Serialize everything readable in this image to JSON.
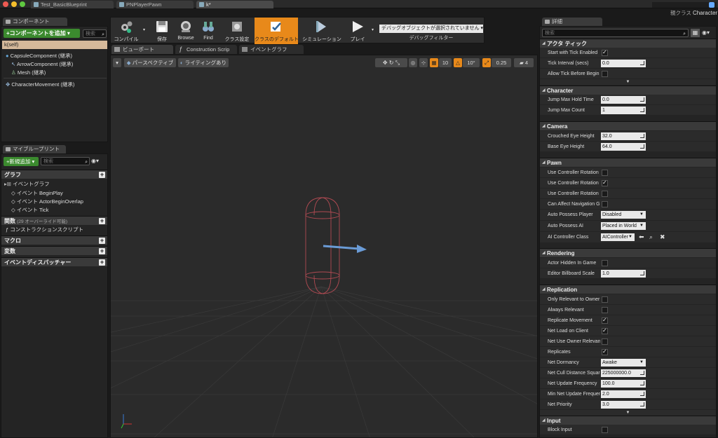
{
  "window": {
    "tabs": [
      "Test_BasicBlueprint",
      "PNPlayerPawn",
      "k*"
    ],
    "parent_class_label": "親クラス",
    "parent_class_value": "Character"
  },
  "components": {
    "tab": "コンポーネント",
    "add_button": "+コンポーネントを追加 ▾",
    "search_placeholder": "検索",
    "self": "k(self)",
    "items": [
      "CapsuleComponent (継承)",
      "ArrowComponent (継承)",
      "Mesh (継承)",
      "CharacterMovement (継承)"
    ]
  },
  "myblueprint": {
    "tab": "マイブループリント",
    "add_button": "+新規追加 ▾",
    "search_placeholder": "検索",
    "graph_header": "グラフ",
    "event_graph": "イベントグラフ",
    "events": [
      "イベント BeginPlay",
      "イベント ActorBeginOverlap",
      "イベント Tick"
    ],
    "functions_header": "関数",
    "functions_note": "(29 オーバーライド可能)",
    "construction": "コンストラクションスクリプト",
    "macros": "マクロ",
    "variables": "変数",
    "dispatchers": "イベントディスパッチャー"
  },
  "toolbar": {
    "compile": "コンパイル",
    "save": "保存",
    "browse": "Browse",
    "find": "Find",
    "class_settings": "クラス設定",
    "class_defaults": "クラスのデフォルト",
    "simulation": "シミュレーション",
    "play": "プレイ",
    "debug_select": "デバッグオブジェクトが選択されていません ▾",
    "debug_filter": "デバッグフィルター"
  },
  "viewport": {
    "tabs": [
      "ビューポート",
      "Construction Scrip",
      "イベントグラフ"
    ],
    "perspective": "パースペクティブ",
    "lighting": "ライティングあり",
    "grid": "10",
    "rot": "10°",
    "scale": "0.25",
    "cam": "4"
  },
  "details": {
    "tab": "詳細",
    "search_placeholder": "検索",
    "actor_tick": {
      "header": "アクタ ティック",
      "start_label": "Start with Tick Enabled",
      "interval_label": "Tick Interval (secs)",
      "interval": "0.0",
      "before_label": "Allow Tick Before Begin"
    },
    "character": {
      "header": "Character",
      "jump_hold_label": "Jump Max Hold Time",
      "jump_hold": "0.0",
      "jump_count_label": "Jump Max Count",
      "jump_count": "1"
    },
    "camera": {
      "header": "Camera",
      "crouched_label": "Crouched Eye Height",
      "crouched": "32.0",
      "base_label": "Base Eye Height",
      "base": "64.0"
    },
    "pawn": {
      "header": "Pawn",
      "ucr1": "Use Controller Rotation P",
      "ucr2": "Use Controller Rotation Y",
      "ucr3": "Use Controller Rotation R",
      "can_affect": "Can Affect Navigation Ge",
      "auto_player_label": "Auto Possess Player",
      "auto_player": "Disabled",
      "auto_ai_label": "Auto Possess AI",
      "auto_ai": "Placed in World",
      "ai_class_label": "AI Controller Class",
      "ai_class": "AIController"
    },
    "rendering": {
      "header": "Rendering",
      "hidden_label": "Actor Hidden In Game",
      "billboard_label": "Editor Billboard Scale",
      "billboard": "1.0"
    },
    "replication": {
      "header": "Replication",
      "only_owner": "Only Relevant to Owner",
      "always": "Always Relevant",
      "replicate_movement": "Replicate Movement",
      "load_client": "Net Load on Client",
      "use_owner": "Net Use Owner Relevanc",
      "replicates": "Replicates",
      "dormancy_label": "Net Dormancy",
      "dormancy": "Awake",
      "cull_label": "Net Cull Distance Square",
      "cull": "225000000.0",
      "update_label": "Net Update Frequency",
      "update": "100.0",
      "min_update_label": "Min Net Update Frequenc",
      "min_update": "2.0",
      "priority_label": "Net Priority",
      "priority": "3.0"
    },
    "input": {
      "header": "Input",
      "block_label": "Block Input"
    }
  },
  "colors": {
    "accent": "#e8891a",
    "green": "#3b8a2e"
  }
}
